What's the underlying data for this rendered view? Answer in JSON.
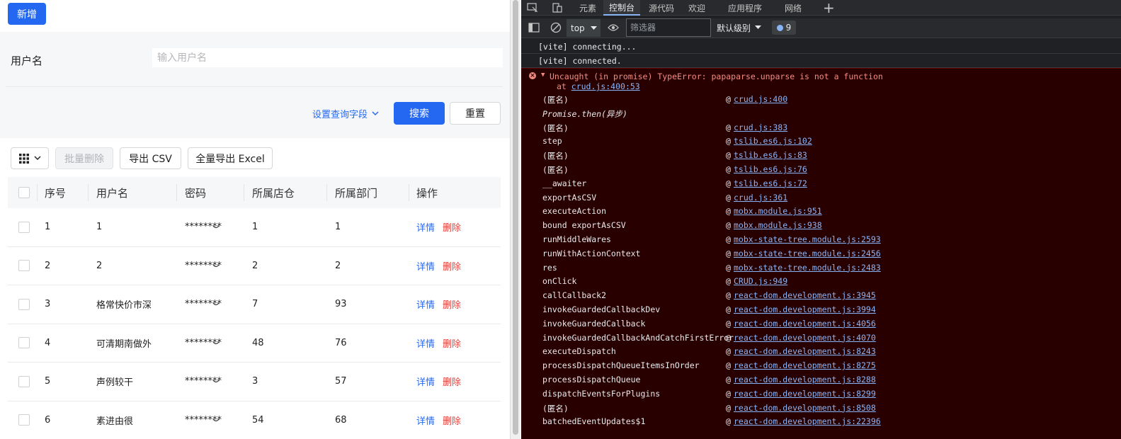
{
  "app": {
    "add_button": "新增",
    "search": {
      "username_label": "用户名",
      "username_placeholder": "输入用户名",
      "field_setting_label": "设置查询字段",
      "search_button": "搜索",
      "reset_button": "重置"
    },
    "toolbar": {
      "bulk_delete": "批量删除",
      "export_csv": "导出 CSV",
      "export_excel": "全量导出 Excel"
    },
    "table": {
      "columns": [
        "序号",
        "用户名",
        "密码",
        "所属店仓",
        "所属部门",
        "操作"
      ],
      "detail_label": "详情",
      "delete_label": "删除",
      "rows": [
        {
          "id": "1",
          "username": "1",
          "password": "********",
          "store": "1",
          "dept": "1"
        },
        {
          "id": "2",
          "username": "2",
          "password": "********",
          "store": "2",
          "dept": "2"
        },
        {
          "id": "3",
          "username": "格常快价市深",
          "password": "********",
          "store": "7",
          "dept": "93"
        },
        {
          "id": "4",
          "username": "可清期南做外",
          "password": "********",
          "store": "48",
          "dept": "76"
        },
        {
          "id": "5",
          "username": "声例较干",
          "password": "********",
          "store": "3",
          "dept": "57"
        },
        {
          "id": "6",
          "username": "素进由很",
          "password": "********",
          "store": "54",
          "dept": "68"
        }
      ]
    }
  },
  "devtools": {
    "tabs": [
      "元素",
      "控制台",
      "源代码",
      "欢迎",
      "应用程序",
      "网络"
    ],
    "active_tab": "控制台",
    "context": "top",
    "filter_placeholder": "筛选器",
    "level": "默认级别",
    "issue_count": "9",
    "logs": [
      "[vite] connecting...",
      "[vite] connected."
    ],
    "error": {
      "message": "Uncaught (in promise) TypeError: papaparse.unparse is not a function",
      "at_prefix": "at ",
      "at_location": "crud.js:400:53",
      "frames": [
        {
          "fn": "(匿名)",
          "loc": "crud.js:400"
        },
        {
          "fn": "Promise.then(异步)",
          "loc": "",
          "async": true
        },
        {
          "fn": "(匿名)",
          "loc": "crud.js:383"
        },
        {
          "fn": "step",
          "loc": "tslib.es6.js:102"
        },
        {
          "fn": "(匿名)",
          "loc": "tslib.es6.js:83"
        },
        {
          "fn": "(匿名)",
          "loc": "tslib.es6.js:76"
        },
        {
          "fn": "__awaiter",
          "loc": "tslib.es6.js:72"
        },
        {
          "fn": "exportAsCSV",
          "loc": "crud.js:361"
        },
        {
          "fn": "executeAction",
          "loc": "mobx.module.js:951"
        },
        {
          "fn": "bound exportAsCSV",
          "loc": "mobx.module.js:938"
        },
        {
          "fn": "runMiddleWares",
          "loc": "mobx-state-tree.module.js:2593"
        },
        {
          "fn": "runWithActionContext",
          "loc": "mobx-state-tree.module.js:2456"
        },
        {
          "fn": "res",
          "loc": "mobx-state-tree.module.js:2483"
        },
        {
          "fn": "onClick",
          "loc": "CRUD.js:949"
        },
        {
          "fn": "callCallback2",
          "loc": "react-dom.development.js:3945"
        },
        {
          "fn": "invokeGuardedCallbackDev",
          "loc": "react-dom.development.js:3994"
        },
        {
          "fn": "invokeGuardedCallback",
          "loc": "react-dom.development.js:4056"
        },
        {
          "fn": "invokeGuardedCallbackAndCatchFirstError",
          "loc": "react-dom.development.js:4070"
        },
        {
          "fn": "executeDispatch",
          "loc": "react-dom.development.js:8243"
        },
        {
          "fn": "processDispatchQueueItemsInOrder",
          "loc": "react-dom.development.js:8275"
        },
        {
          "fn": "processDispatchQueue",
          "loc": "react-dom.development.js:8288"
        },
        {
          "fn": "dispatchEventsForPlugins",
          "loc": "react-dom.development.js:8299"
        },
        {
          "fn": "(匿名)",
          "loc": "react-dom.development.js:8508"
        },
        {
          "fn": "batchedEventUpdates$1",
          "loc": "react-dom.development.js:22396"
        }
      ]
    }
  },
  "colors": {
    "primary": "#2468f2",
    "danger": "#e8413c",
    "devtools_bg": "#202124",
    "error_bg": "#290000",
    "error_text": "#f28b82",
    "link": "#8ab4f8"
  }
}
